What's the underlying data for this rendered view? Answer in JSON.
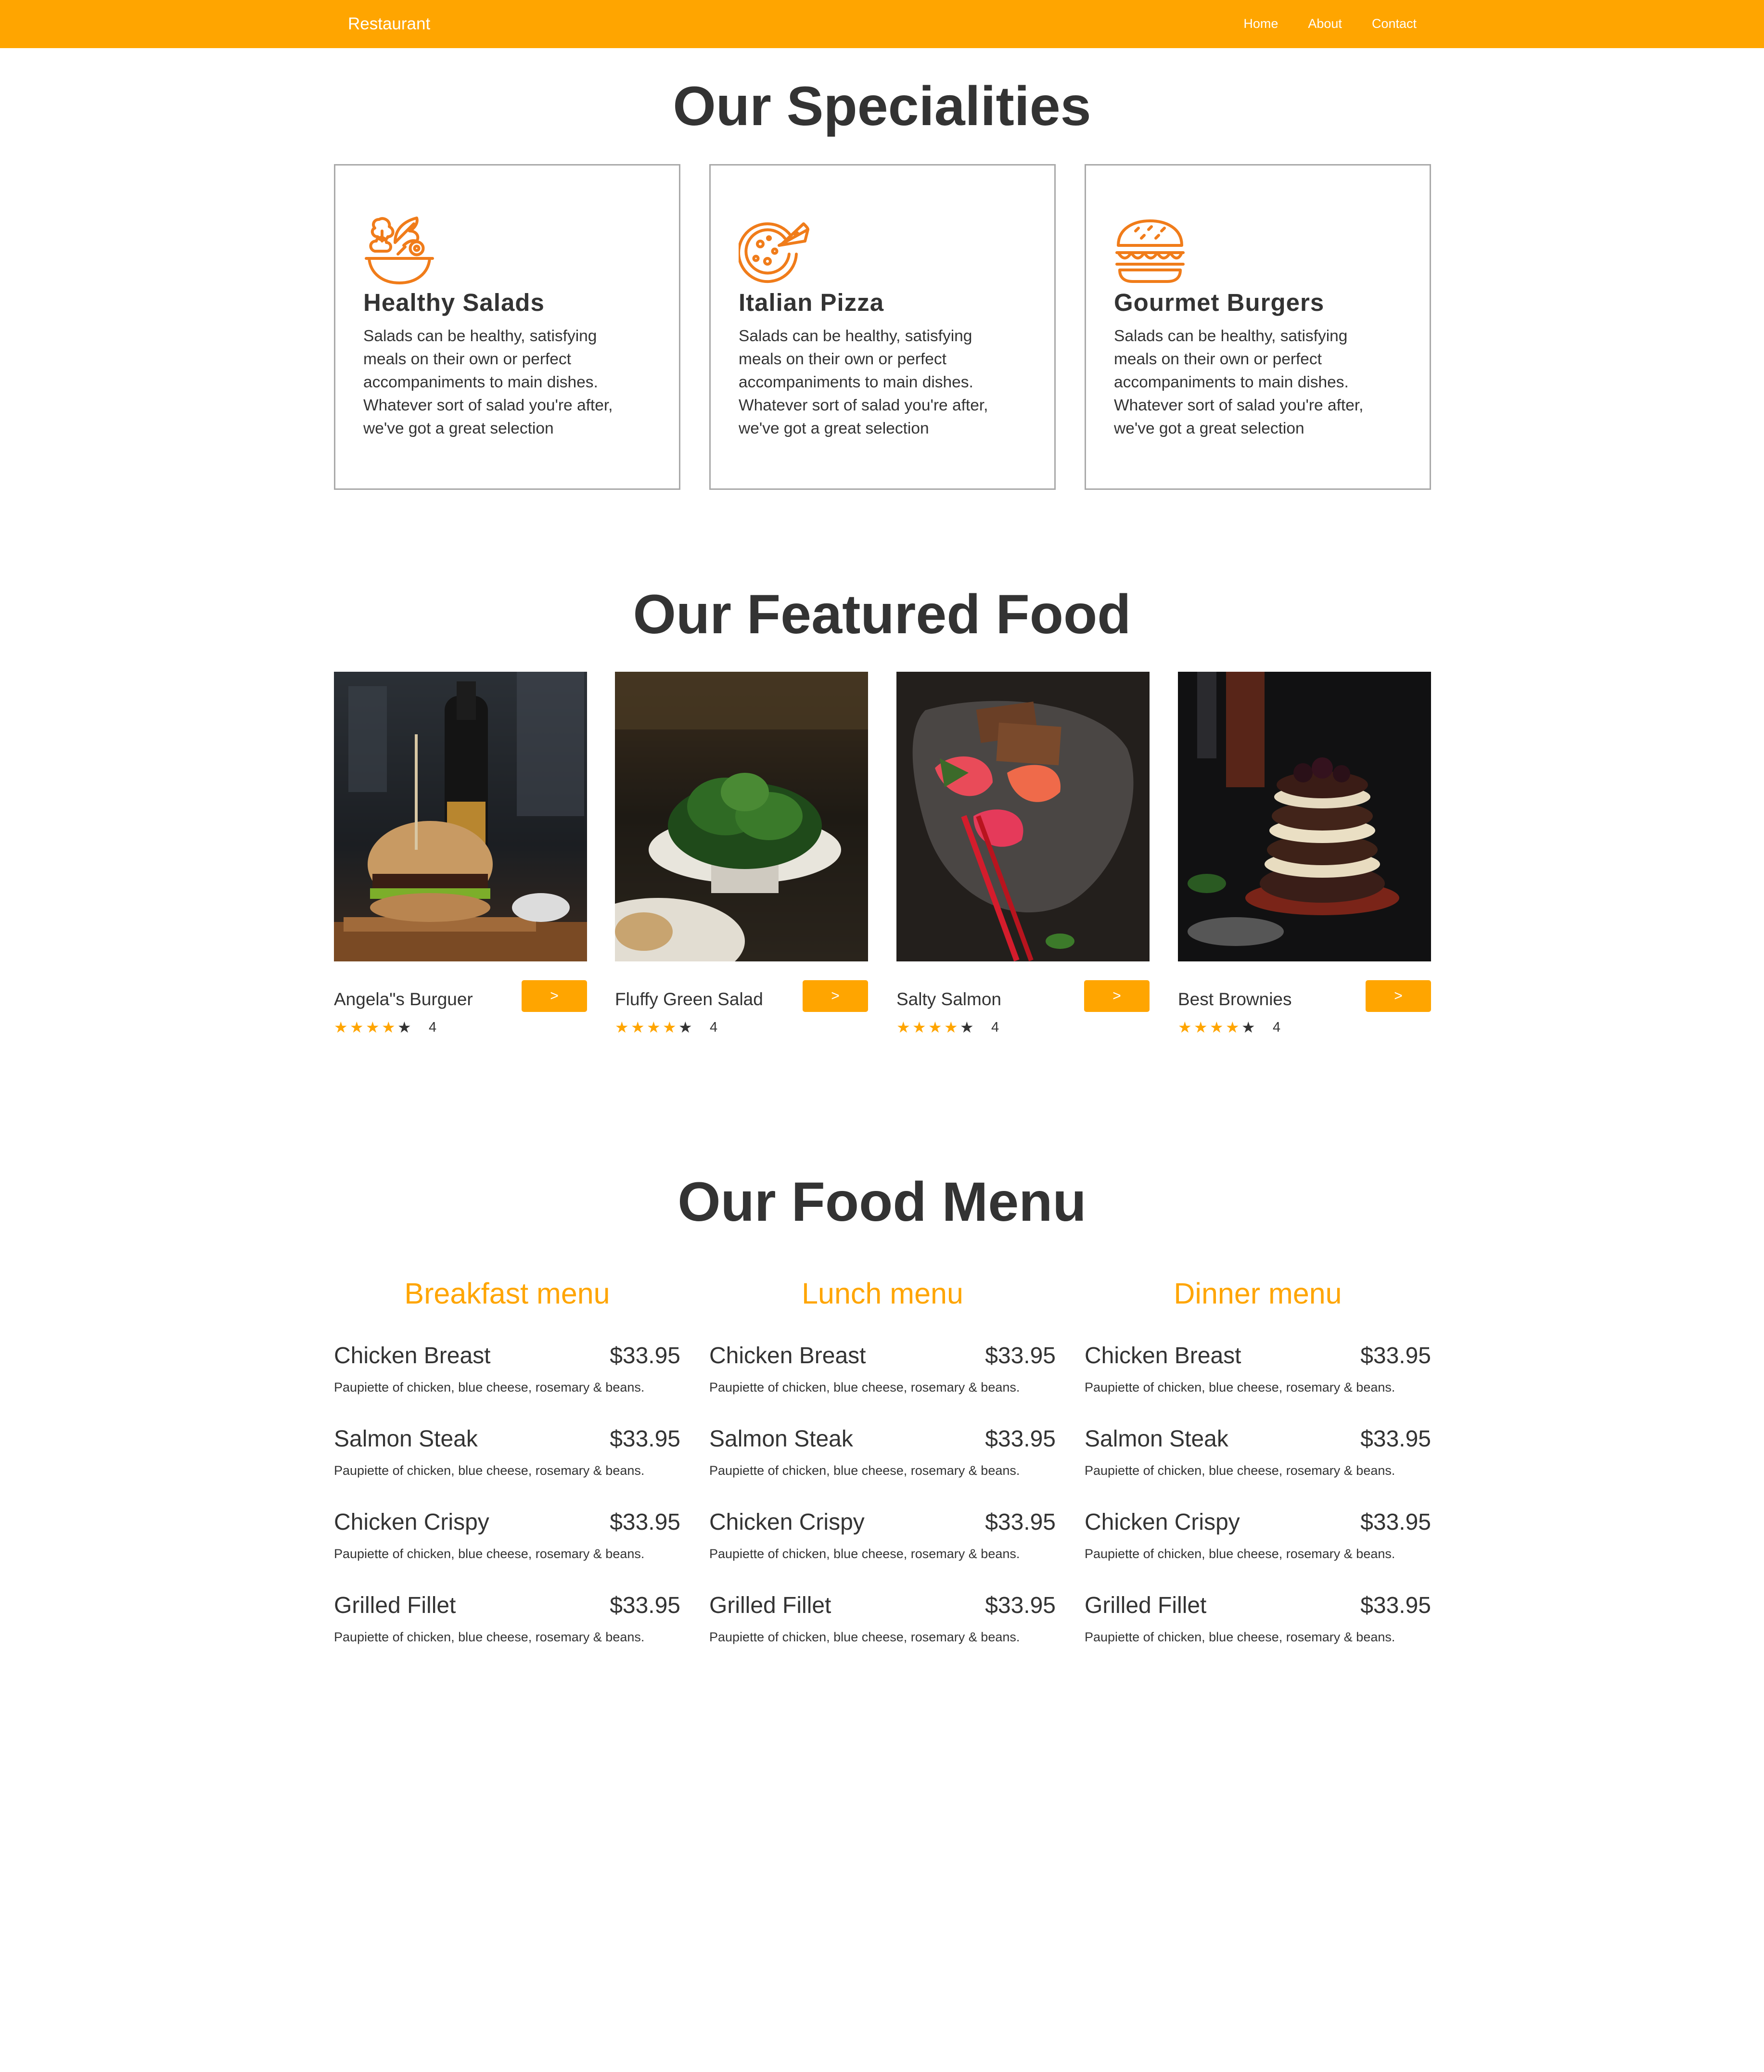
{
  "nav": {
    "brand": "Restaurant",
    "links": [
      "Home",
      "About",
      "Contact"
    ]
  },
  "specialities": {
    "title": "Our Specialities",
    "cards": [
      {
        "icon": "salad-bowl-icon",
        "title": "Healthy Salads",
        "desc": "Salads can be healthy, satisfying meals on their own or perfect accompaniments to main dishes. Whatever sort of salad you're after, we've got a great selection"
      },
      {
        "icon": "pizza-icon",
        "title": "Italian Pizza",
        "desc": "Salads can be healthy, satisfying meals on their own or perfect accompaniments to main dishes. Whatever sort of salad you're after, we've got a great selection"
      },
      {
        "icon": "burger-icon",
        "title": "Gourmet Burgers",
        "desc": "Salads can be healthy, satisfying meals on their own or perfect accompaniments to main dishes. Whatever sort of salad you're after, we've got a great selection"
      }
    ]
  },
  "featured": {
    "title": "Our Featured Food",
    "items": [
      {
        "name": "Angela\"s Burguer",
        "button": ">",
        "stars_filled": 4,
        "stars_total": 5,
        "rating": "4"
      },
      {
        "name": "Fluffy Green Salad",
        "button": ">",
        "stars_filled": 4,
        "stars_total": 5,
        "rating": "4"
      },
      {
        "name": "Salty Salmon",
        "button": ">",
        "stars_filled": 4,
        "stars_total": 5,
        "rating": "4"
      },
      {
        "name": "Best Brownies",
        "button": ">",
        "stars_filled": 4,
        "stars_total": 5,
        "rating": "4"
      }
    ]
  },
  "menu": {
    "title": "Our Food Menu",
    "columns": [
      {
        "heading": "Breakfast menu",
        "items": [
          {
            "name": "Chicken Breast",
            "price": "$33.95",
            "desc": "Paupiette of chicken, blue cheese, rosemary & beans."
          },
          {
            "name": "Salmon Steak",
            "price": "$33.95",
            "desc": "Paupiette of chicken, blue cheese, rosemary & beans."
          },
          {
            "name": "Chicken Crispy",
            "price": "$33.95",
            "desc": "Paupiette of chicken, blue cheese, rosemary & beans."
          },
          {
            "name": "Grilled Fillet",
            "price": "$33.95",
            "desc": "Paupiette of chicken, blue cheese, rosemary & beans."
          }
        ]
      },
      {
        "heading": "Lunch menu",
        "items": [
          {
            "name": "Chicken Breast",
            "price": "$33.95",
            "desc": "Paupiette of chicken, blue cheese, rosemary & beans."
          },
          {
            "name": "Salmon Steak",
            "price": "$33.95",
            "desc": "Paupiette of chicken, blue cheese, rosemary & beans."
          },
          {
            "name": "Chicken Crispy",
            "price": "$33.95",
            "desc": "Paupiette of chicken, blue cheese, rosemary & beans."
          },
          {
            "name": "Grilled Fillet",
            "price": "$33.95",
            "desc": "Paupiette of chicken, blue cheese, rosemary & beans."
          }
        ]
      },
      {
        "heading": "Dinner menu",
        "items": [
          {
            "name": "Chicken Breast",
            "price": "$33.95",
            "desc": "Paupiette of chicken, blue cheese, rosemary & beans."
          },
          {
            "name": "Salmon Steak",
            "price": "$33.95",
            "desc": "Paupiette of chicken, blue cheese, rosemary & beans."
          },
          {
            "name": "Chicken Crispy",
            "price": "$33.95",
            "desc": "Paupiette of chicken, blue cheese, rosemary & beans."
          },
          {
            "name": "Grilled Fillet",
            "price": "$33.95",
            "desc": "Paupiette of chicken, blue cheese, rosemary & beans."
          }
        ]
      }
    ]
  },
  "colors": {
    "accent": "#ffa500",
    "icon_stroke": "#f07c1a",
    "text": "#333333"
  }
}
